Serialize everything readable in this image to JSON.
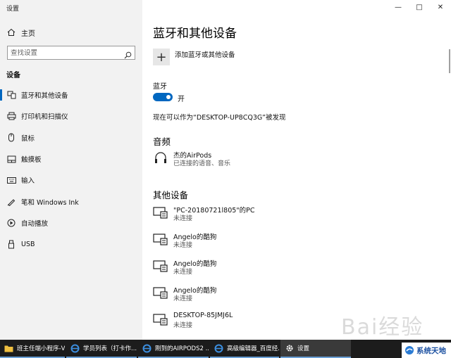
{
  "window": {
    "title": "设置",
    "controls": [
      "—",
      "□",
      "✕"
    ]
  },
  "sidebar": {
    "home": "主页",
    "search_placeholder": "查找设置",
    "section": "设备",
    "items": [
      {
        "label": "蓝牙和其他设备",
        "icon": "bluetooth-devices-icon",
        "active": true
      },
      {
        "label": "打印机和扫描仪",
        "icon": "printer-icon"
      },
      {
        "label": "鼠标",
        "icon": "mouse-icon"
      },
      {
        "label": "触摸板",
        "icon": "touchpad-icon"
      },
      {
        "label": "输入",
        "icon": "keyboard-icon"
      },
      {
        "label": "笔和 Windows Ink",
        "icon": "pen-icon"
      },
      {
        "label": "自动播放",
        "icon": "autoplay-icon"
      },
      {
        "label": "USB",
        "icon": "usb-icon"
      }
    ]
  },
  "main": {
    "title": "蓝牙和其他设备",
    "add_device": "添加蓝牙或其他设备",
    "bluetooth_label": "蓝牙",
    "toggle_state": "开",
    "discoverable": "现在可以作为“DESKTOP-UP8CQ3G”被发现",
    "audio_title": "音频",
    "audio_devices": [
      {
        "name": "杰的AirPods",
        "status": "已连接的语音、音乐"
      }
    ],
    "other_title": "其他设备",
    "other_devices": [
      {
        "name": "\"PC-20180721l805\"的PC",
        "status": "未连接"
      },
      {
        "name": "Angelo的酷狗",
        "status": "未连接"
      },
      {
        "name": "Angelo的酷狗",
        "status": "未连接"
      },
      {
        "name": "Angelo的酷狗",
        "status": "未连接"
      },
      {
        "name": "DESKTOP-85JMJ6L",
        "status": "未连接"
      }
    ]
  },
  "watermark": "Bai经验",
  "taskbar": {
    "items": [
      {
        "label": "班主任端小程序-V...",
        "icon": "folder-icon"
      },
      {
        "label": "学员列表（打卡作...",
        "icon": "ie-icon"
      },
      {
        "label": "刚到的AIRPODS2 ...",
        "icon": "ie-icon"
      },
      {
        "label": "高级编辑器_百度经...",
        "icon": "ie-icon"
      },
      {
        "label": "设置",
        "icon": "gear-icon"
      }
    ],
    "brand": "系统天地"
  },
  "colors": {
    "accent": "#0067c0",
    "sidebar_bg": "#f2f2f2",
    "taskbar_bg": "#1c1c1c"
  }
}
